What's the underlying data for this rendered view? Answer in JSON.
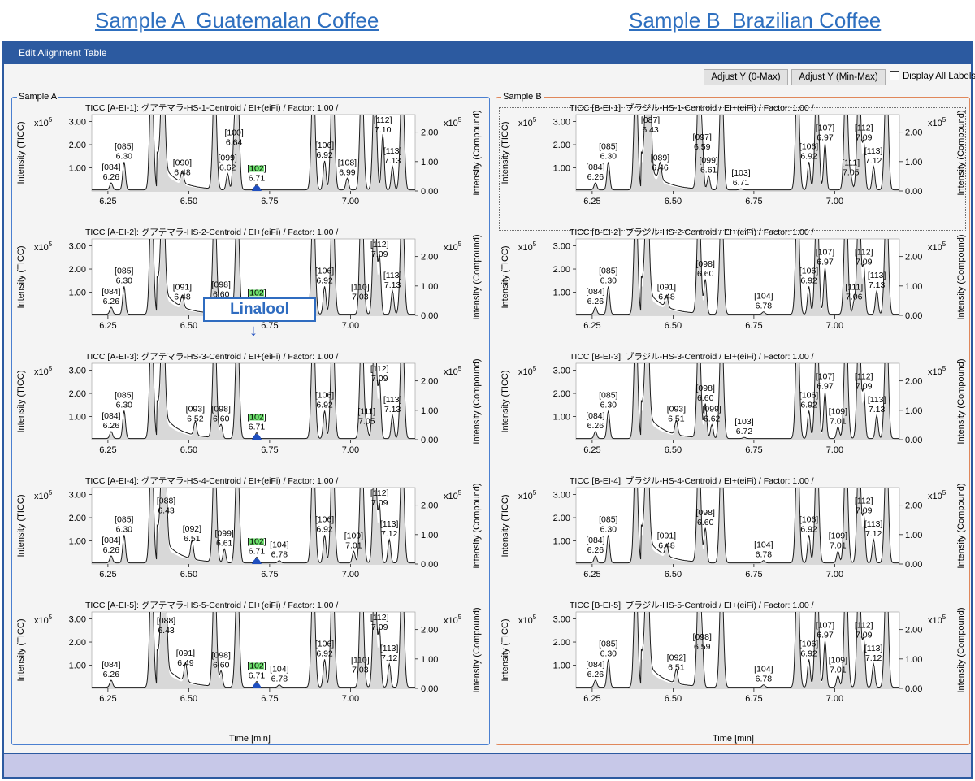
{
  "headings": {
    "a": "Sample A  Guatemalan Coffee",
    "b": "Sample B  Brazilian Coffee"
  },
  "window": {
    "title": "Edit Alignment Table"
  },
  "toolbar": {
    "adjust_0max": "Adjust Y (0-Max)",
    "adjust_minmax": "Adjust Y (Min-Max)",
    "display_all_labels": "Display All Labels",
    "display_all_labels_checked": false
  },
  "annotation": {
    "text": "Linalool",
    "arrow": "↓"
  },
  "axis": {
    "y_left_label": "Intensity (TICC)",
    "y_right_label": "Intensity (Compound)",
    "x_label": "Time [min]",
    "exp_base": "x10",
    "exp_power": "5",
    "y_left_ticks": [
      "1.00",
      "2.00",
      "3.00"
    ],
    "y_right_ticks": [
      "0.00",
      "1.00",
      "2.00"
    ],
    "x_ticks": [
      "6.25",
      "6.50",
      "6.75",
      "7.00"
    ]
  },
  "colors": {
    "trace": "#1a1a1a",
    "fill": "#d8d8d8",
    "highlight_peak": "#1f4fbf",
    "highlight_label": "#5ee05e",
    "group_a": "#4a7fd0",
    "group_b": "#e0875a",
    "title_bar": "#2c5aa0"
  },
  "chart_data": [
    {
      "type": "line",
      "group": "Sample A",
      "group_label": "Sample A",
      "title": "TICC [A-EI-1]: グアテマラ-HS-1-Centroid / EI+(eiFi) / Factor: 1.00 /",
      "x_range": [
        6.2,
        7.2
      ],
      "ylim_left": [
        0,
        3.3
      ],
      "ylim_right": [
        0,
        2.6
      ],
      "peaks": [
        {
          "id": "[084]",
          "rt": "6.26",
          "x": 6.26,
          "h": 0.3
        },
        {
          "id": "[085]",
          "rt": "6.30",
          "x": 6.3,
          "h": 1.2
        },
        {
          "id": "[090]",
          "rt": "6.48",
          "x": 6.48,
          "h": 0.5
        },
        {
          "id": "[099]",
          "rt": "6.62",
          "x": 6.62,
          "h": 0.7
        },
        {
          "id": "[100]",
          "rt": "6.64",
          "x": 6.64,
          "h": 1.8
        },
        {
          "id": "[102]",
          "rt": "6.71",
          "x": 6.71,
          "h": 0.25,
          "highlight": true
        },
        {
          "id": "[106]",
          "rt": "6.92",
          "x": 6.92,
          "h": 1.25
        },
        {
          "id": "[108]",
          "rt": "6.99",
          "x": 6.99,
          "h": 0.5
        },
        {
          "id": "[112]",
          "rt": "7.10",
          "x": 7.1,
          "h": 2.4
        },
        {
          "id": "[113]",
          "rt": "7.13",
          "x": 7.13,
          "h": 1.0
        }
      ]
    },
    {
      "type": "line",
      "group": "Sample A",
      "title": "TICC [A-EI-2]: グアテマラ-HS-2-Centroid / EI+(eiFi) / Factor: 1.00 /",
      "x_range": [
        6.2,
        7.2
      ],
      "ylim_left": [
        0,
        3.3
      ],
      "ylim_right": [
        0,
        2.6
      ],
      "peaks": [
        {
          "id": "[084]",
          "rt": "6.26",
          "x": 6.26,
          "h": 0.3
        },
        {
          "id": "[085]",
          "rt": "6.30",
          "x": 6.3,
          "h": 1.2
        },
        {
          "id": "[091]",
          "rt": "6.48",
          "x": 6.48,
          "h": 0.5
        },
        {
          "id": "[098]",
          "rt": "6.60",
          "x": 6.6,
          "h": 0.6
        },
        {
          "id": "[102]",
          "rt": "6.71",
          "x": 6.71,
          "h": 0.25,
          "highlight": true
        },
        {
          "id": "[106]",
          "rt": "6.92",
          "x": 6.92,
          "h": 1.2
        },
        {
          "id": "[110]",
          "rt": "7.03",
          "x": 7.03,
          "h": 0.5
        },
        {
          "id": "[112]",
          "rt": "7.09",
          "x": 7.09,
          "h": 2.4
        },
        {
          "id": "[113]",
          "rt": "7.13",
          "x": 7.13,
          "h": 1.0
        }
      ]
    },
    {
      "type": "line",
      "group": "Sample A",
      "title": "TICC [A-EI-3]: グアテマラ-HS-3-Centroid / EI+(eiFi) / Factor: 1.00 /",
      "x_range": [
        6.2,
        7.2
      ],
      "ylim_left": [
        0,
        3.3
      ],
      "ylim_right": [
        0,
        2.6
      ],
      "peaks": [
        {
          "id": "[084]",
          "rt": "6.26",
          "x": 6.26,
          "h": 0.3
        },
        {
          "id": "[085]",
          "rt": "6.30",
          "x": 6.3,
          "h": 1.2
        },
        {
          "id": "[093]",
          "rt": "6.52",
          "x": 6.52,
          "h": 0.6
        },
        {
          "id": "[098]",
          "rt": "6.60",
          "x": 6.6,
          "h": 0.6
        },
        {
          "id": "[102]",
          "rt": "6.71",
          "x": 6.71,
          "h": 0.25,
          "highlight": true
        },
        {
          "id": "[106]",
          "rt": "6.92",
          "x": 6.92,
          "h": 1.2
        },
        {
          "id": "[111]",
          "rt": "7.05",
          "x": 7.05,
          "h": 0.5
        },
        {
          "id": "[112]",
          "rt": "7.09",
          "x": 7.09,
          "h": 2.4
        },
        {
          "id": "[113]",
          "rt": "7.13",
          "x": 7.13,
          "h": 1.0
        }
      ]
    },
    {
      "type": "line",
      "group": "Sample A",
      "title": "TICC [A-EI-4]: グアテマラ-HS-4-Centroid / EI+(eiFi) / Factor: 1.00 /",
      "x_range": [
        6.2,
        7.2
      ],
      "ylim_left": [
        0,
        3.3
      ],
      "ylim_right": [
        0,
        2.6
      ],
      "peaks": [
        {
          "id": "[084]",
          "rt": "6.26",
          "x": 6.26,
          "h": 0.3
        },
        {
          "id": "[085]",
          "rt": "6.30",
          "x": 6.3,
          "h": 1.2
        },
        {
          "id": "[088]",
          "rt": "6.43",
          "x": 6.43,
          "h": 2.0
        },
        {
          "id": "[092]",
          "rt": "6.51",
          "x": 6.51,
          "h": 0.8
        },
        {
          "id": "[099]",
          "rt": "6.61",
          "x": 6.61,
          "h": 0.6
        },
        {
          "id": "[102]",
          "rt": "6.71",
          "x": 6.71,
          "h": 0.25,
          "highlight": true
        },
        {
          "id": "[104]",
          "rt": "6.78",
          "x": 6.78,
          "h": 0.1
        },
        {
          "id": "[106]",
          "rt": "6.92",
          "x": 6.92,
          "h": 1.2
        },
        {
          "id": "[109]",
          "rt": "7.01",
          "x": 7.01,
          "h": 0.5
        },
        {
          "id": "[112]",
          "rt": "7.09",
          "x": 7.09,
          "h": 2.4
        },
        {
          "id": "[113]",
          "rt": "7.12",
          "x": 7.12,
          "h": 1.0
        }
      ]
    },
    {
      "type": "line",
      "group": "Sample A",
      "title": "TICC [A-EI-5]: グアテマラ-HS-5-Centroid / EI+(eiFi) / Factor: 1.00 /",
      "x_range": [
        6.2,
        7.2
      ],
      "ylim_left": [
        0,
        3.3
      ],
      "ylim_right": [
        0,
        2.6
      ],
      "xlabel": "Time [min]",
      "peaks": [
        {
          "id": "[084]",
          "rt": "6.26",
          "x": 6.26,
          "h": 0.3
        },
        {
          "id": "[088]",
          "rt": "6.43",
          "x": 6.43,
          "h": 2.2
        },
        {
          "id": "[091]",
          "rt": "6.49",
          "x": 6.49,
          "h": 0.8
        },
        {
          "id": "[098]",
          "rt": "6.60",
          "x": 6.6,
          "h": 0.7
        },
        {
          "id": "[102]",
          "rt": "6.71",
          "x": 6.71,
          "h": 0.25,
          "highlight": true
        },
        {
          "id": "[104]",
          "rt": "6.78",
          "x": 6.78,
          "h": 0.1
        },
        {
          "id": "[106]",
          "rt": "6.92",
          "x": 6.92,
          "h": 1.2
        },
        {
          "id": "[110]",
          "rt": "7.03",
          "x": 7.03,
          "h": 0.5
        },
        {
          "id": "[112]",
          "rt": "7.09",
          "x": 7.09,
          "h": 2.4
        },
        {
          "id": "[113]",
          "rt": "7.12",
          "x": 7.12,
          "h": 1.0
        }
      ]
    },
    {
      "type": "line",
      "group": "Sample B",
      "group_label": "Sample B",
      "title": "TICC [B-EI-1]: ブラジル-HS-1-Centroid / EI+(eiFi) / Factor: 1.00 /",
      "x_range": [
        6.2,
        7.2
      ],
      "ylim_left": [
        0,
        3.3
      ],
      "ylim_right": [
        0,
        2.6
      ],
      "peaks": [
        {
          "id": "[084]",
          "rt": "6.26",
          "x": 6.26,
          "h": 0.3
        },
        {
          "id": "[085]",
          "rt": "6.30",
          "x": 6.3,
          "h": 1.2
        },
        {
          "id": "[087]",
          "rt": "6.43",
          "x": 6.43,
          "h": 2.6
        },
        {
          "id": "[089]",
          "rt": "6.46",
          "x": 6.46,
          "h": 0.7
        },
        {
          "id": "[097]",
          "rt": "6.59",
          "x": 6.59,
          "h": 1.6
        },
        {
          "id": "[099]",
          "rt": "6.61",
          "x": 6.61,
          "h": 0.6
        },
        {
          "id": "[103]",
          "rt": "6.71",
          "x": 6.71,
          "h": 0.05
        },
        {
          "id": "[106]",
          "rt": "6.92",
          "x": 6.92,
          "h": 1.2
        },
        {
          "id": "[107]",
          "rt": "6.97",
          "x": 6.97,
          "h": 2.0
        },
        {
          "id": "[111]",
          "rt": "7.05",
          "x": 7.05,
          "h": 0.5
        },
        {
          "id": "[112]",
          "rt": "7.09",
          "x": 7.09,
          "h": 2.0
        },
        {
          "id": "[113]",
          "rt": "7.12",
          "x": 7.12,
          "h": 1.0
        }
      ]
    },
    {
      "type": "line",
      "group": "Sample B",
      "title": "TICC [B-EI-2]: ブラジル-HS-2-Centroid / EI+(eiFi) / Factor: 1.00 /",
      "x_range": [
        6.2,
        7.2
      ],
      "ylim_left": [
        0,
        3.3
      ],
      "ylim_right": [
        0,
        2.6
      ],
      "peaks": [
        {
          "id": "[084]",
          "rt": "6.26",
          "x": 6.26,
          "h": 0.3
        },
        {
          "id": "[085]",
          "rt": "6.30",
          "x": 6.3,
          "h": 1.2
        },
        {
          "id": "[091]",
          "rt": "6.48",
          "x": 6.48,
          "h": 0.5
        },
        {
          "id": "[098]",
          "rt": "6.60",
          "x": 6.6,
          "h": 1.5
        },
        {
          "id": "[104]",
          "rt": "6.78",
          "x": 6.78,
          "h": 0.1
        },
        {
          "id": "[106]",
          "rt": "6.92",
          "x": 6.92,
          "h": 1.2
        },
        {
          "id": "[107]",
          "rt": "6.97",
          "x": 6.97,
          "h": 2.0
        },
        {
          "id": "[111]",
          "rt": "7.06",
          "x": 7.06,
          "h": 0.5
        },
        {
          "id": "[112]",
          "rt": "7.09",
          "x": 7.09,
          "h": 2.0
        },
        {
          "id": "[113]",
          "rt": "7.13",
          "x": 7.13,
          "h": 1.0
        }
      ]
    },
    {
      "type": "line",
      "group": "Sample B",
      "title": "TICC [B-EI-3]: ブラジル-HS-3-Centroid / EI+(eiFi) / Factor: 1.00 /",
      "x_range": [
        6.2,
        7.2
      ],
      "ylim_left": [
        0,
        3.3
      ],
      "ylim_right": [
        0,
        2.6
      ],
      "peaks": [
        {
          "id": "[084]",
          "rt": "6.26",
          "x": 6.26,
          "h": 0.3
        },
        {
          "id": "[085]",
          "rt": "6.30",
          "x": 6.3,
          "h": 1.2
        },
        {
          "id": "[093]",
          "rt": "6.51",
          "x": 6.51,
          "h": 0.6
        },
        {
          "id": "[098]",
          "rt": "6.60",
          "x": 6.6,
          "h": 1.5
        },
        {
          "id": "[099]",
          "rt": "6.62",
          "x": 6.62,
          "h": 0.6
        },
        {
          "id": "[103]",
          "rt": "6.72",
          "x": 6.72,
          "h": 0.05
        },
        {
          "id": "[106]",
          "rt": "6.92",
          "x": 6.92,
          "h": 1.2
        },
        {
          "id": "[107]",
          "rt": "6.97",
          "x": 6.97,
          "h": 2.0
        },
        {
          "id": "[109]",
          "rt": "7.01",
          "x": 7.01,
          "h": 0.5
        },
        {
          "id": "[112]",
          "rt": "7.09",
          "x": 7.09,
          "h": 2.0
        },
        {
          "id": "[113]",
          "rt": "7.13",
          "x": 7.13,
          "h": 1.0
        }
      ]
    },
    {
      "type": "line",
      "group": "Sample B",
      "title": "TICC [B-EI-4]: ブラジル-HS-4-Centroid / EI+(eiFi) / Factor: 1.00 /",
      "x_range": [
        6.2,
        7.2
      ],
      "ylim_left": [
        0,
        3.3
      ],
      "ylim_right": [
        0,
        2.6
      ],
      "peaks": [
        {
          "id": "[084]",
          "rt": "6.26",
          "x": 6.26,
          "h": 0.3
        },
        {
          "id": "[085]",
          "rt": "6.30",
          "x": 6.3,
          "h": 1.2
        },
        {
          "id": "[091]",
          "rt": "6.48",
          "x": 6.48,
          "h": 0.5
        },
        {
          "id": "[098]",
          "rt": "6.60",
          "x": 6.6,
          "h": 1.5
        },
        {
          "id": "[104]",
          "rt": "6.78",
          "x": 6.78,
          "h": 0.1
        },
        {
          "id": "[106]",
          "rt": "6.92",
          "x": 6.92,
          "h": 1.2
        },
        {
          "id": "[109]",
          "rt": "7.01",
          "x": 7.01,
          "h": 0.5
        },
        {
          "id": "[112]",
          "rt": "7.09",
          "x": 7.09,
          "h": 2.0
        },
        {
          "id": "[113]",
          "rt": "7.12",
          "x": 7.12,
          "h": 1.0
        }
      ]
    },
    {
      "type": "line",
      "group": "Sample B",
      "title": "TICC [B-EI-5]: ブラジル-HS-5-Centroid / EI+(eiFi) / Factor: 1.00 /",
      "x_range": [
        6.2,
        7.2
      ],
      "ylim_left": [
        0,
        3.3
      ],
      "ylim_right": [
        0,
        2.6
      ],
      "xlabel": "Time [min]",
      "peaks": [
        {
          "id": "[084]",
          "rt": "6.26",
          "x": 6.26,
          "h": 0.3
        },
        {
          "id": "[085]",
          "rt": "6.30",
          "x": 6.3,
          "h": 1.2
        },
        {
          "id": "[092]",
          "rt": "6.51",
          "x": 6.51,
          "h": 0.6
        },
        {
          "id": "[098]",
          "rt": "6.59",
          "x": 6.59,
          "h": 1.5
        },
        {
          "id": "[104]",
          "rt": "6.78",
          "x": 6.78,
          "h": 0.1
        },
        {
          "id": "[106]",
          "rt": "6.92",
          "x": 6.92,
          "h": 1.2
        },
        {
          "id": "[107]",
          "rt": "6.97",
          "x": 6.97,
          "h": 2.0
        },
        {
          "id": "[109]",
          "rt": "7.01",
          "x": 7.01,
          "h": 0.5
        },
        {
          "id": "[112]",
          "rt": "7.09",
          "x": 7.09,
          "h": 2.0
        },
        {
          "id": "[113]",
          "rt": "7.12",
          "x": 7.12,
          "h": 1.0
        }
      ]
    }
  ]
}
